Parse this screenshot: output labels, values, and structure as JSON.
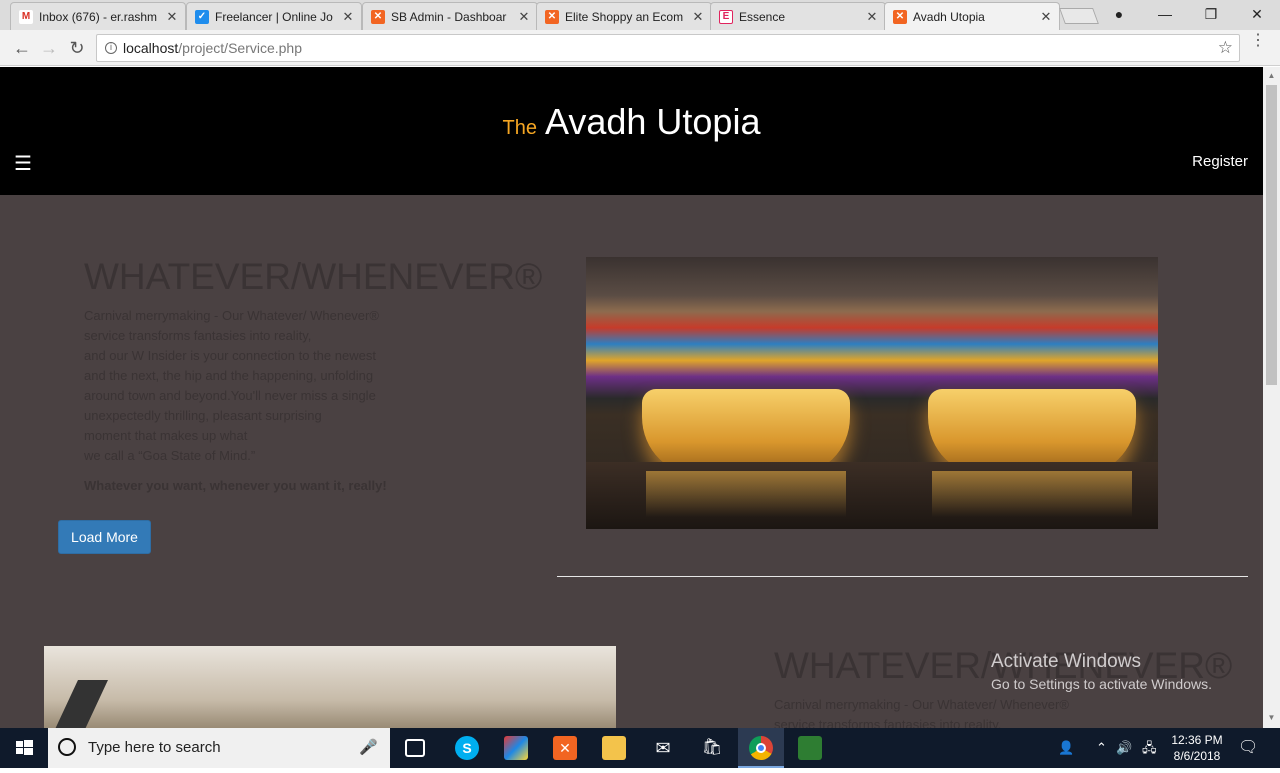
{
  "browser": {
    "tabs": [
      {
        "label": "Inbox (676) - er.rashm",
        "favicon": "gmail-icon",
        "color": "#d93025",
        "letter": "M"
      },
      {
        "label": "Freelancer | Online Jo",
        "favicon": "freelancer-icon",
        "color": "#1f8ded",
        "letter": "✓"
      },
      {
        "label": "SB Admin - Dashboar",
        "favicon": "xampp-icon",
        "color": "#f26522",
        "letter": "✕"
      },
      {
        "label": "Elite Shoppy an Ecom",
        "favicon": "xampp-icon",
        "color": "#f26522",
        "letter": "✕"
      },
      {
        "label": "Essence",
        "favicon": "essence-icon",
        "color": "#e0245e",
        "letter": "E"
      },
      {
        "label": "Avadh Utopia",
        "favicon": "xampp-icon",
        "color": "#f26522",
        "letter": "✕"
      }
    ],
    "address": {
      "host": "localhost",
      "path": "/project/Service.php"
    }
  },
  "site": {
    "brand_prefix": "The",
    "brand_name": "Avadh Utopia",
    "register_label": "Register",
    "menu_icon": "☰"
  },
  "section1": {
    "title": "WHATEVER/WHENEVER®",
    "lines": [
      "Carnival merrymaking - Our Whatever/ Whenever®",
      "service transforms fantasies into reality,",
      "and our W Insider is your connection to the newest",
      "and the next, the hip and the happening, unfolding",
      "around town and beyond.You'll never miss a single",
      "unexpectedly thrilling, pleasant surprising",
      "moment that makes up what",
      "we call a “Goa State of Mind.”"
    ],
    "tagline": "Whatever you want, whenever you want it, really!",
    "button_label": "Load More"
  },
  "section2": {
    "title": "WHATEVER/WHENEVER®",
    "lines": [
      "Carnival merrymaking - Our Whatever/ Whenever®",
      "service transforms fantasies into reality,"
    ]
  },
  "watermark": {
    "line1": "Activate Windows",
    "line2": "Go to Settings to activate Windows."
  },
  "taskbar": {
    "search_placeholder": "Type here to search",
    "time": "12:36 PM",
    "date": "8/6/2018"
  }
}
